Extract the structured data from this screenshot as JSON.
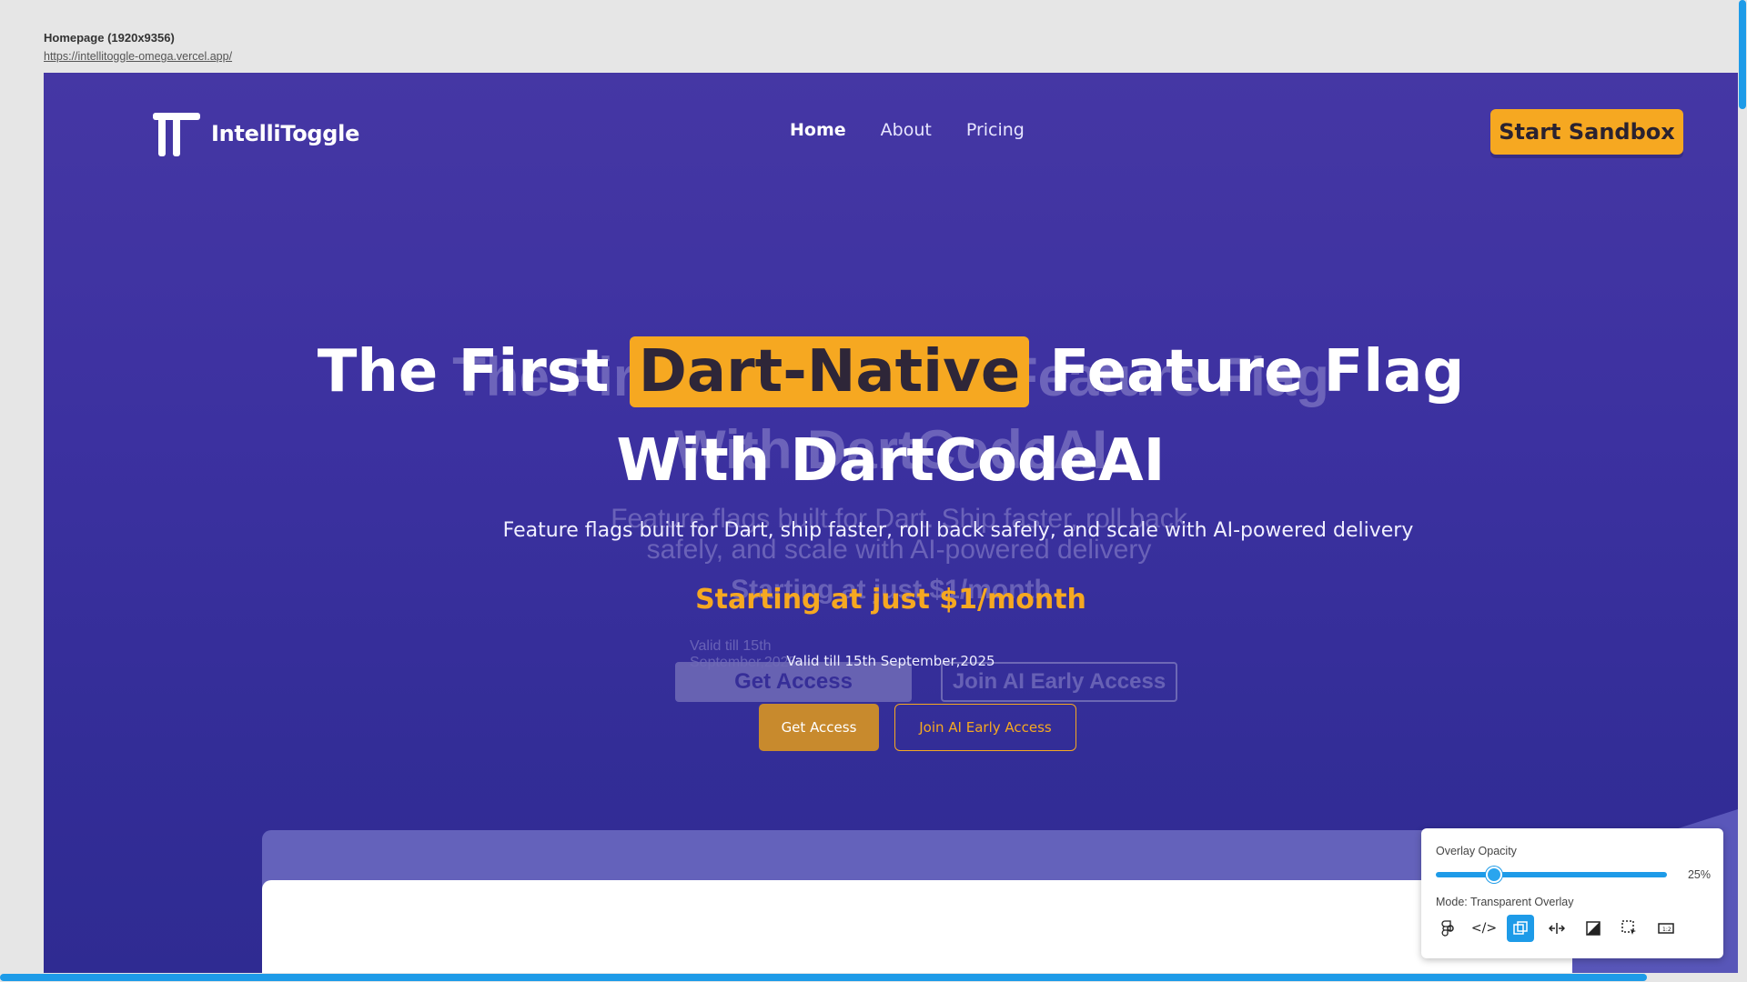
{
  "frame": {
    "title": "Homepage (1920x9356)",
    "url": "https://intellitoggle-omega.vercel.app/"
  },
  "nav": {
    "brand": "IntelliToggle",
    "items": [
      "Home",
      "About",
      "Pricing"
    ],
    "cta": "Start Sandbox"
  },
  "hero": {
    "title_before": "The First",
    "title_highlight": "Dart-Native",
    "title_after": "Feature Flag",
    "title_line2": "With DartCodeAI",
    "subtitle": "Feature flags built for Dart, ship faster, roll back safely, and scale with AI-powered delivery",
    "price": "Starting at just $1/month",
    "valid": "Valid till 15th September,2025",
    "primary_button": "Get Access",
    "secondary_button": "Join AI Early Access"
  },
  "ghost": {
    "title_line1": "The First Dart-Native Feature Flag",
    "title_line2": "With DartCodeAI",
    "subtitle": "Feature flags built for Dart. Ship faster, roll back safely, and scale with AI-powered delivery",
    "price": "Starting at just $1/month",
    "valid": "Valid till 15th September,2025",
    "primary_button": "Get Access",
    "secondary_button": "Join AI Early Access"
  },
  "overlay_widget": {
    "label": "Overlay Opacity",
    "opacity_value": 25,
    "opacity_text": "25%",
    "mode": "Mode: Transparent Overlay",
    "tools": [
      "figma-icon",
      "code-icon",
      "overlay-icon",
      "split-icon",
      "contrast-icon",
      "select-icon",
      "measure-icon"
    ]
  },
  "colors": {
    "accent": "#f6a821",
    "background": "#4537a4",
    "widget_accent": "#1e9be8"
  }
}
